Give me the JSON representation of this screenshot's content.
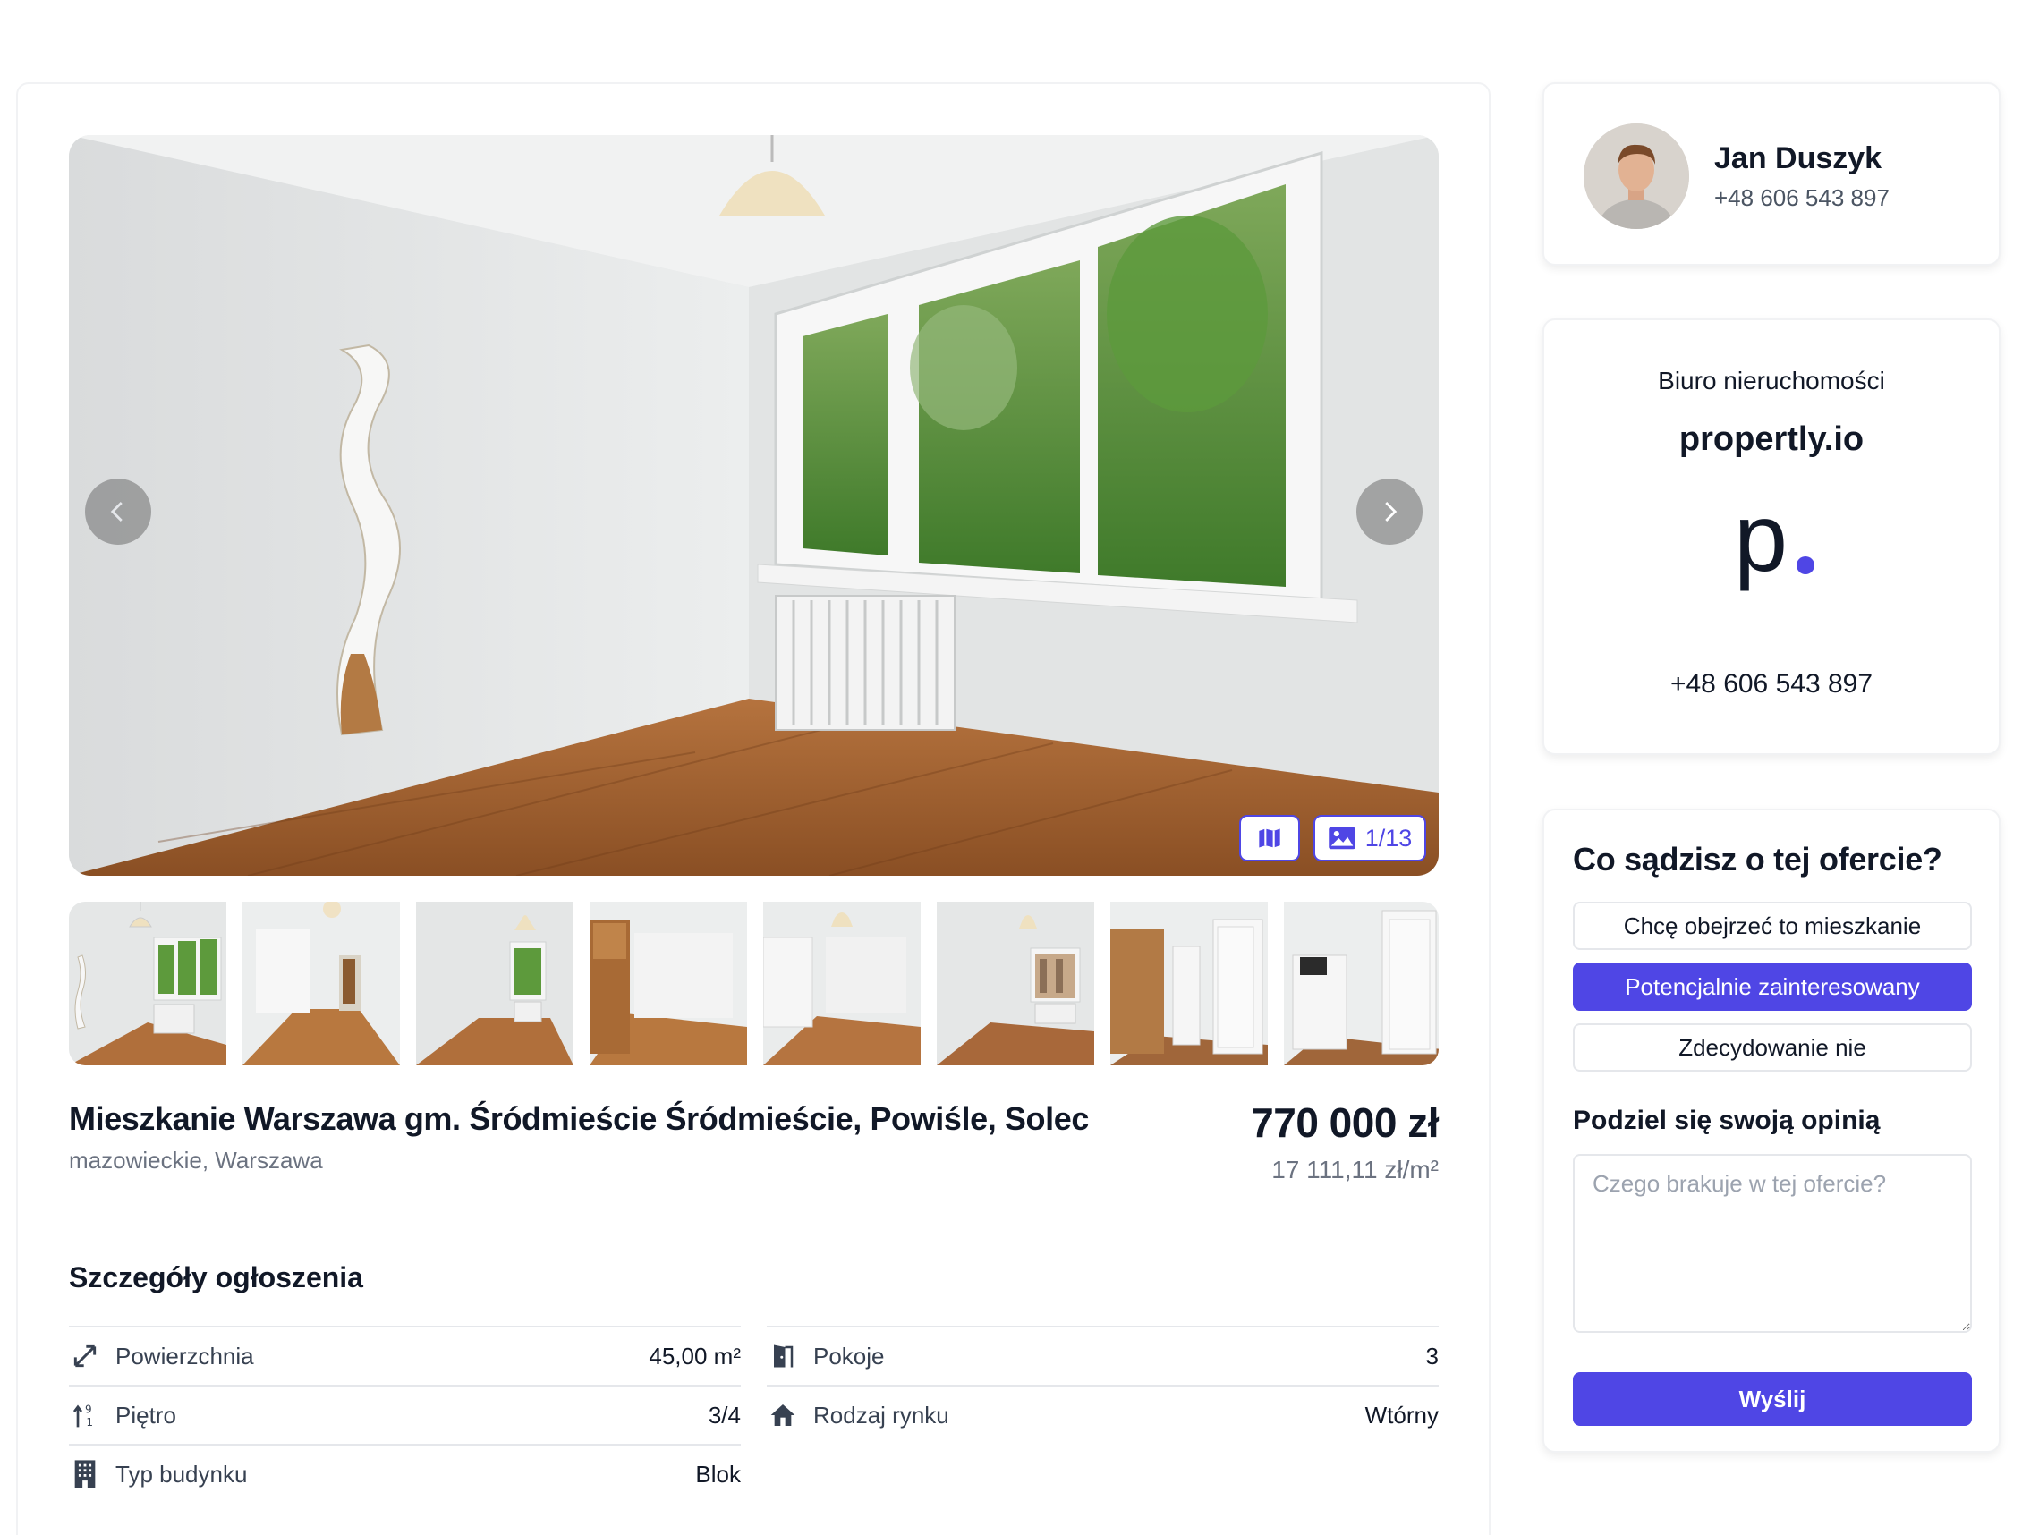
{
  "gallery": {
    "counter": "1/13",
    "icons": {
      "prev": "chevron-left-icon",
      "next": "chevron-right-icon",
      "map": "map-icon",
      "photos": "image-icon"
    },
    "thumbnail_count": 8
  },
  "listing": {
    "title": "Mieszkanie Warszawa gm. Śródmieście Śródmieście, Powiśle, Solec",
    "location": "mazowieckie, Warszawa",
    "price": "770 000 zł",
    "price_per_m2": "17 111,11 zł/m²"
  },
  "details": {
    "title": "Szczegóły ogłoszenia",
    "rows": [
      {
        "icon": "arrows-diagonal-icon",
        "label": "Powierzchnia",
        "value": "45,00 m²"
      },
      {
        "icon": "door-icon",
        "label": "Pokoje",
        "value": "3"
      },
      {
        "icon": "floor-icon",
        "label": "Piętro",
        "value": "3/4"
      },
      {
        "icon": "house-icon",
        "label": "Rodzaj rynku",
        "value": "Wtórny"
      },
      {
        "icon": "building-icon",
        "label": "Typ budynku",
        "value": "Blok"
      }
    ]
  },
  "agent": {
    "name": "Jan Duszyk",
    "phone": "+48 606 543 897"
  },
  "agency": {
    "label": "Biuro nieruchomości",
    "name": "propertly.io",
    "logo_letter": "p",
    "phone": "+48 606 543 897",
    "accent": "#4f46e5"
  },
  "feedback": {
    "title": "Co sądzisz o tej ofercie?",
    "options": [
      {
        "label": "Chcę obejrzeć to mieszkanie",
        "selected": false
      },
      {
        "label": "Potencjalnie zainteresowany",
        "selected": true
      },
      {
        "label": "Zdecydowanie nie",
        "selected": false
      }
    ],
    "opinion_title": "Podziel się swoją opinią",
    "placeholder": "Czego brakuje w tej ofercie?",
    "submit": "Wyślij"
  },
  "colors": {
    "accent": "#4f46e5",
    "text": "#111827",
    "muted": "#6b7280"
  }
}
